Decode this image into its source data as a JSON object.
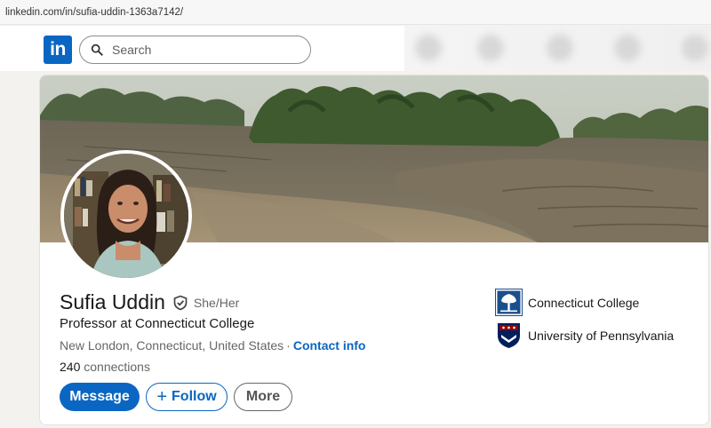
{
  "browser": {
    "url": "linkedin.com/in/sufia-uddin-1363a7142/"
  },
  "header": {
    "logo_text": "in",
    "search_placeholder": "Search",
    "search_icon": "search-icon"
  },
  "profile": {
    "name": "Sufia Uddin",
    "pronouns": "She/Her",
    "headline": "Professor at Connecticut College",
    "location": "New London, Connecticut, United States",
    "separator": "·",
    "contact_info": "Contact info",
    "connections_count": "240",
    "connections_label": "connections",
    "education": [
      {
        "name": "Connecticut College",
        "icon": "connecticut-college-logo"
      },
      {
        "name": "University of Pennsylvania",
        "icon": "upenn-shield-logo"
      }
    ]
  },
  "actions": {
    "message": "Message",
    "follow": "Follow",
    "follow_icon": "+",
    "more": "More"
  },
  "colors": {
    "brand": "#0a66c2",
    "text": "#191919",
    "muted": "#666666",
    "background": "#f3f2ef"
  }
}
